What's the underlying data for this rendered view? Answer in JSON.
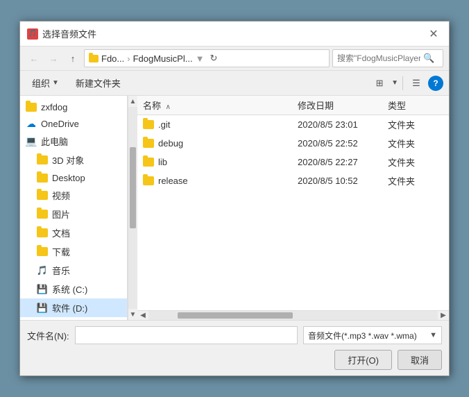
{
  "dialog": {
    "title": "选择音频文件",
    "icon": "🎵"
  },
  "nav": {
    "back_disabled": true,
    "forward_disabled": true,
    "up_label": "↑",
    "breadcrumb": {
      "part1": "Fdo...",
      "sep1": "›",
      "part2": "FdogMusicPl...",
      "dropdown": "▼"
    },
    "refresh": "↻",
    "search_placeholder": "搜索\"FdogMusicPlayer\"",
    "search_icon": "🔍"
  },
  "toolbar": {
    "organize_label": "组织",
    "organize_dropdown": "▼",
    "new_folder_label": "新建文件夹",
    "view_icon1": "⊞",
    "view_icon2": "☰",
    "help_icon": "?"
  },
  "sidebar": {
    "items": [
      {
        "id": "zxfdog",
        "label": "zxfdog",
        "type": "folder",
        "active": false
      },
      {
        "id": "onedrive",
        "label": "OneDrive",
        "type": "cloud",
        "active": false
      },
      {
        "id": "thispc",
        "label": "此电脑",
        "type": "pc",
        "active": false
      },
      {
        "id": "3dobjects",
        "label": "3D 对象",
        "type": "folder-sub",
        "active": false
      },
      {
        "id": "desktop",
        "label": "Desktop",
        "type": "folder-sub",
        "active": false
      },
      {
        "id": "videos",
        "label": "视频",
        "type": "folder-sub",
        "active": false
      },
      {
        "id": "pictures",
        "label": "图片",
        "type": "folder-sub",
        "active": false
      },
      {
        "id": "documents",
        "label": "文档",
        "type": "folder-sub",
        "active": false
      },
      {
        "id": "downloads",
        "label": "下载",
        "type": "folder-sub",
        "active": false
      },
      {
        "id": "music",
        "label": "音乐",
        "type": "folder-sub",
        "active": false
      },
      {
        "id": "systemc",
        "label": "系统 (C:)",
        "type": "drive-sub",
        "active": false
      },
      {
        "id": "softwared",
        "label": "软件 (D:)",
        "type": "drive-sub",
        "active": true
      }
    ]
  },
  "file_list": {
    "columns": {
      "name": "名称",
      "date": "修改日期",
      "type": "类型",
      "sort_arrow": "∧"
    },
    "files": [
      {
        "name": ".git",
        "date": "2020/8/5 23:01",
        "type": "文件夹"
      },
      {
        "name": "debug",
        "date": "2020/8/5 22:52",
        "type": "文件夹"
      },
      {
        "name": "lib",
        "date": "2020/8/5 22:27",
        "type": "文件夹"
      },
      {
        "name": "release",
        "date": "2020/8/5 10:52",
        "type": "文件夹"
      }
    ]
  },
  "bottom": {
    "filename_label": "文件名(N):",
    "filename_value": "",
    "filetype_label": "音频文件(*.mp3 *.wav *.wma)",
    "filetype_dropdown": "▼",
    "open_label": "打开(O)",
    "cancel_label": "取消"
  }
}
